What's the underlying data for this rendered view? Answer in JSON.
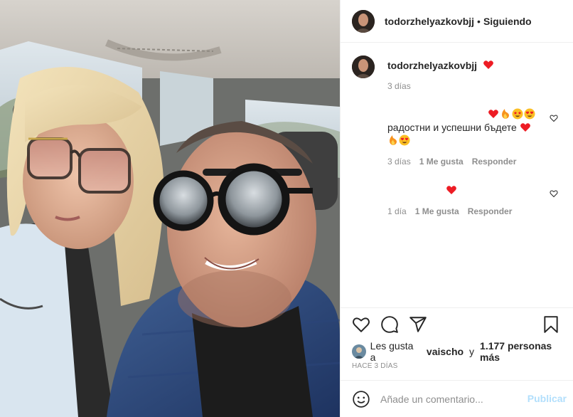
{
  "header": {
    "username": "todorzhelyazkovbjj",
    "separator": "•",
    "follow_status": "Siguiendo"
  },
  "caption": {
    "username": "todorzhelyazkovbjj",
    "emoji": "heart",
    "time": "3 días"
  },
  "comments": [
    {
      "emojis_line1": [
        "heart",
        "fire",
        "star-eyes",
        "heart-eyes"
      ],
      "text": "радостни и успешни бъдете",
      "emojis_trailing": [
        "heart",
        "fire",
        "heart-eyes"
      ],
      "time": "3 días",
      "likes": "1 Me gusta",
      "reply": "Responder"
    },
    {
      "emojis": [
        "heart"
      ],
      "time": "1 día",
      "likes": "1 Me gusta",
      "reply": "Responder"
    }
  ],
  "likes": {
    "prefix": "Les gusta a",
    "user": "vaischo",
    "conjunction": "y",
    "others": "1.177 personas más"
  },
  "posted_ago": "HACE 3 DÍAS",
  "add_comment": {
    "placeholder": "Añade un comentario...",
    "publish_label": "Publicar"
  },
  "icons": {
    "like": "heart-outline-icon",
    "comment": "comment-icon",
    "share": "paper-plane-icon",
    "save": "bookmark-icon",
    "emoji": "smiley-icon"
  },
  "colors": {
    "link_disabled": "#b2dffc",
    "muted": "#8e8e8e",
    "text": "#262626",
    "heart": "#ed1c24"
  }
}
